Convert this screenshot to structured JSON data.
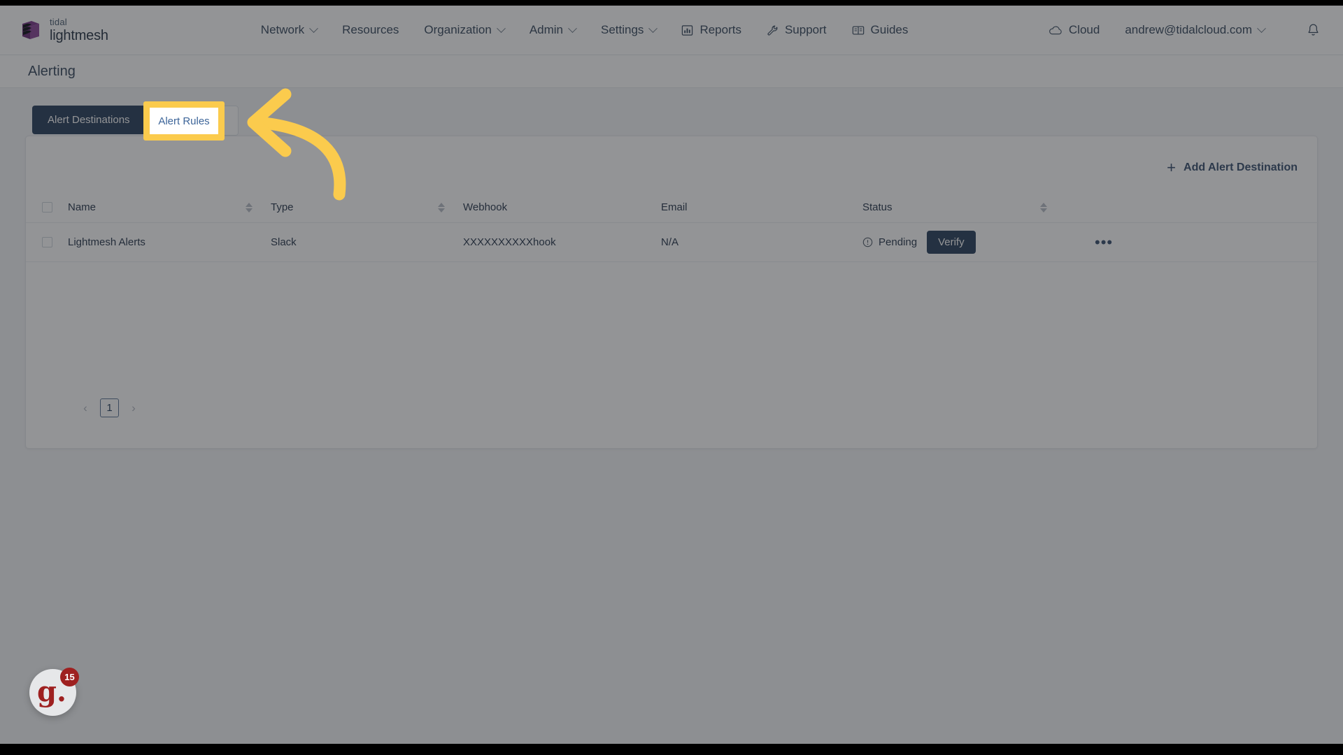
{
  "brand": {
    "top_word": "tidal",
    "bottom_word": "lightmesh",
    "logo_icon": "stacked-layers-logo",
    "accent_purple": "#7d3c8c",
    "accent_dark": "#2d3a4a"
  },
  "nav": {
    "items": [
      {
        "label": "Network",
        "icon": "none",
        "caret": true
      },
      {
        "label": "Resources",
        "icon": "none",
        "caret": false
      },
      {
        "label": "Organization",
        "icon": "none",
        "caret": true
      },
      {
        "label": "Admin",
        "icon": "none",
        "caret": true
      },
      {
        "label": "Settings",
        "icon": "none",
        "caret": true
      },
      {
        "label": "Reports",
        "icon": "bar-chart-icon",
        "caret": false
      },
      {
        "label": "Support",
        "icon": "wrench-icon",
        "caret": false
      },
      {
        "label": "Guides",
        "icon": "book-icon",
        "caret": false
      }
    ],
    "right": {
      "cloud_label": "Cloud",
      "cloud_icon": "cloud-icon",
      "account_email": "andrew@tidalcloud.com",
      "account_caret": true,
      "notifications_icon": "bell-icon"
    }
  },
  "page": {
    "title": "Alerting"
  },
  "tabs": [
    {
      "label": "Alert Destinations",
      "active": true
    },
    {
      "label": "Alert Rules",
      "active": false
    }
  ],
  "toolbar": {
    "add_label": "Add Alert Destination",
    "add_icon": "plus-icon"
  },
  "table": {
    "columns": [
      {
        "label": "Name",
        "sortable": true
      },
      {
        "label": "Type",
        "sortable": true
      },
      {
        "label": "Webhook",
        "sortable": false
      },
      {
        "label": "Email",
        "sortable": false
      },
      {
        "label": "Status",
        "sortable": true
      }
    ],
    "rows": [
      {
        "name": "Lightmesh Alerts",
        "type": "Slack",
        "webhook": "XXXXXXXXXXhook",
        "email": "N/A",
        "status_label": "Pending",
        "status_icon": "alert-circle-icon",
        "action_label": "Verify",
        "overflow_icon": "ellipsis-icon"
      }
    ]
  },
  "pagination": {
    "prev_icon": "chevron-left-icon",
    "next_icon": "chevron-right-icon",
    "current_page": "1"
  },
  "overlay": {
    "highlight_target": "Alert Rules",
    "arrow_icon": "curved-arrow-left-icon",
    "highlight_color": "#fbcb4d"
  },
  "guidde": {
    "letter": "g.",
    "badge_count": "15"
  }
}
